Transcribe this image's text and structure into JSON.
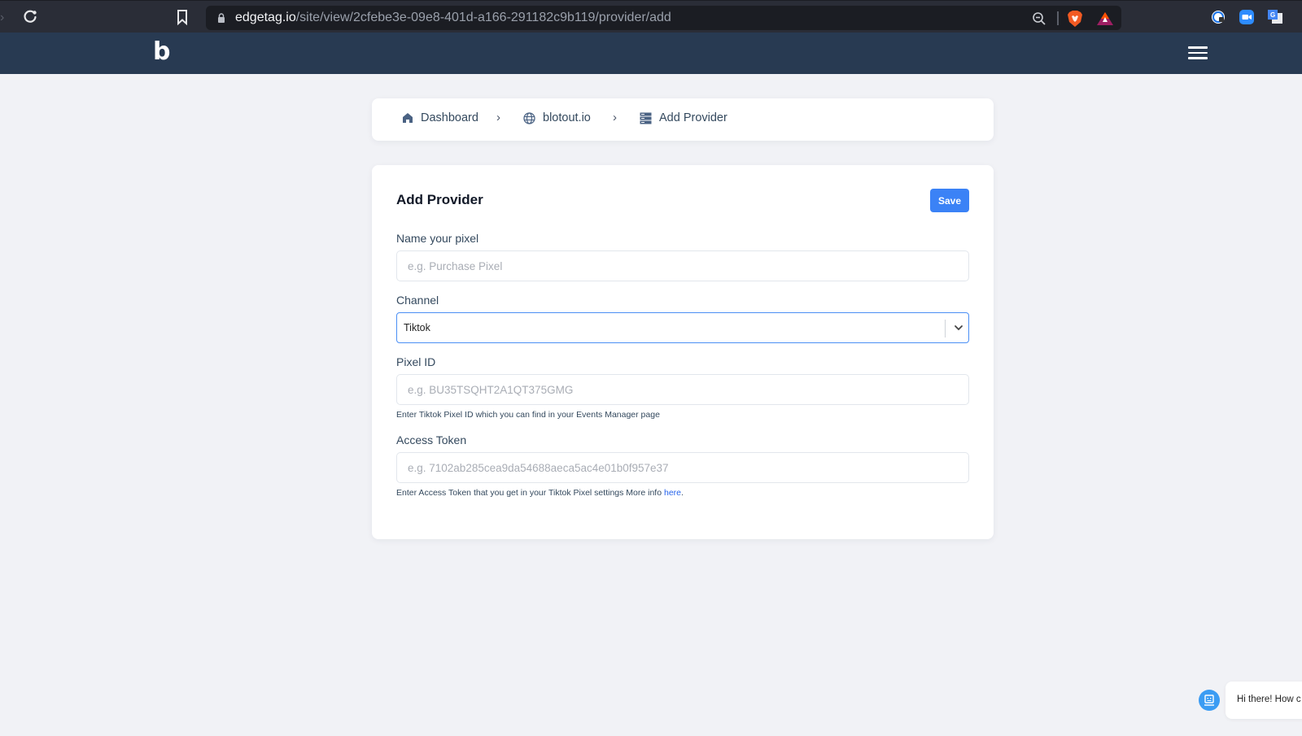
{
  "browser": {
    "url_host": "edgetag.io",
    "url_path": "/site/view/2cfebe3e-09e8-401d-a166-291182c9b119/provider/add"
  },
  "header": {
    "logo": "b"
  },
  "breadcrumb": [
    {
      "label": "Dashboard",
      "icon": "home-icon"
    },
    {
      "label": "blotout.io",
      "icon": "globe-icon"
    },
    {
      "label": "Add Provider",
      "icon": "server-icon"
    }
  ],
  "breadcrumb_separator": "›",
  "form": {
    "title": "Add Provider",
    "save_label": "Save",
    "name": {
      "label": "Name your pixel",
      "value": "",
      "placeholder": "e.g. Purchase Pixel"
    },
    "channel": {
      "label": "Channel",
      "selected": "Tiktok"
    },
    "pixel_id": {
      "label": "Pixel ID",
      "value": "",
      "placeholder": "e.g. BU35TSQHT2A1QT375GMG",
      "help": "Enter Tiktok Pixel ID which you can find in your Events Manager page"
    },
    "access_token": {
      "label": "Access Token",
      "value": "",
      "placeholder": "e.g. 7102ab285cea9da54688aeca5ac4e01b0f957e37",
      "help_prefix": "Enter Access Token that you get in your Tiktok Pixel settings More info ",
      "help_link": "here",
      "help_suffix": "."
    }
  },
  "chat": {
    "greeting": "Hi there! How c"
  },
  "colors": {
    "header_bg": "#283a52",
    "page_bg": "#f1f2f6",
    "accent": "#3b82f6",
    "text": "#34495e"
  }
}
